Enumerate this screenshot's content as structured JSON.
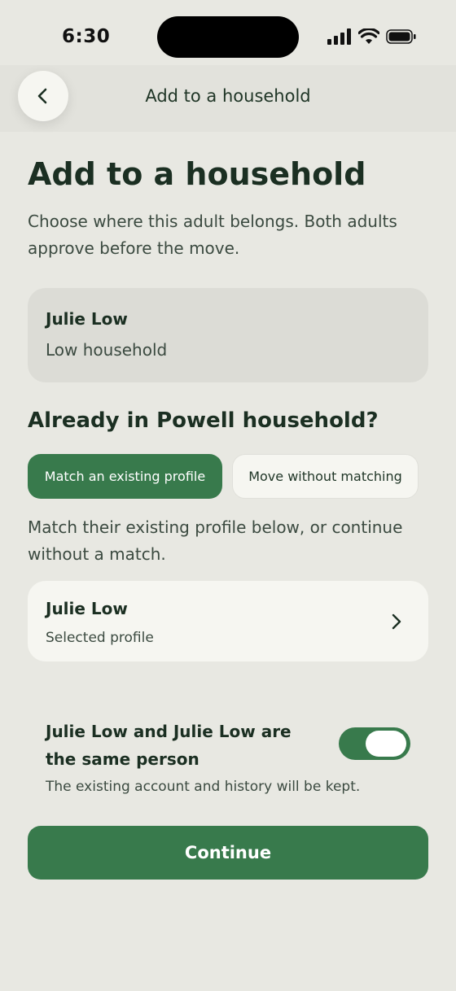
{
  "status_bar": {
    "time": "6:30"
  },
  "header": {
    "title": "Add to a household",
    "back_icon": "chevron-left-icon"
  },
  "page": {
    "title": "Add to a household",
    "intro": "Choose where this adult belongs. Both adults approve before the move."
  },
  "current_card": {
    "name": "Julie Low",
    "household": "Low household"
  },
  "section": {
    "title": "Already in Powell household?"
  },
  "segments": [
    {
      "label": "Match an existing profile",
      "selected": true
    },
    {
      "label": "Move without matching",
      "selected": false
    }
  ],
  "helper_text": "Match their existing profile below, or continue without a match.",
  "profile_card": {
    "name": "Julie Low",
    "subtitle": "Selected profile",
    "icon": "chevron-right-icon"
  },
  "same_person": {
    "title": "Julie Low and Julie Low are the same person",
    "description": "The existing account and history will be kept.",
    "toggle_on": true
  },
  "continue_label": "Continue",
  "colors": {
    "accent": "#387a4c",
    "background": "#e8e8e2",
    "card": "#f6f6f1"
  }
}
